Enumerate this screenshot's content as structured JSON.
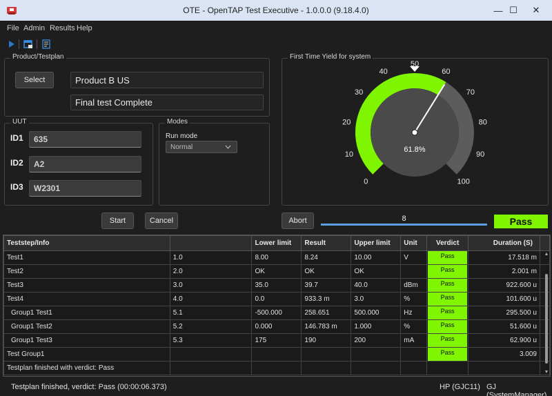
{
  "window": {
    "title": "OTE - OpenTAP Test Executive - 1.0.0.0 (9.18.4.0)",
    "minimize_glyph": "—",
    "maximize_glyph": "☐",
    "close_glyph": "✕"
  },
  "menu": [
    "File",
    "Admin",
    "Results",
    "Help"
  ],
  "toolbar": {
    "icons": [
      "play-icon",
      "edit-plan-icon",
      "report-icon"
    ]
  },
  "product": {
    "group_label": "Product/Testplan",
    "select_label": "Select",
    "product_name": "Product B US",
    "testplan_name": "Final test Complete"
  },
  "uut": {
    "group_label": "UUT",
    "ids": [
      {
        "label": "ID1",
        "value": "635"
      },
      {
        "label": "ID2",
        "value": "A2"
      },
      {
        "label": "ID3",
        "value": "W2301"
      }
    ]
  },
  "modes": {
    "group_label": "Modes",
    "run_mode_label": "Run mode",
    "run_mode_value": "Normal"
  },
  "gauge": {
    "group_label": "First Time Yield for system",
    "value_text": "61.8%",
    "value": 61.8,
    "min": 0,
    "max": 100,
    "tick_labels": [
      "0",
      "10",
      "20",
      "30",
      "40",
      "50",
      "60",
      "70",
      "80",
      "90",
      "100"
    ],
    "arc_color": "#7ff500",
    "needle_color": "#ffffff"
  },
  "controls": {
    "start_label": "Start",
    "cancel_label": "Cancel",
    "abort_label": "Abort",
    "progress_text": "8",
    "progress_fraction": 1.0,
    "verdict": "Pass",
    "verdict_color": "#7ff500"
  },
  "results": {
    "columns": [
      "Teststep/Info",
      "",
      "Lower limit",
      "Result",
      "Upper limit",
      "Unit",
      "Verdict",
      "Duration (S)"
    ],
    "rows": [
      {
        "step": "Test1",
        "id": "1.0",
        "lower": "8.00",
        "result": "8.24",
        "upper": "10.00",
        "unit": "V",
        "verdict": "Pass",
        "duration": "17.518 m"
      },
      {
        "step": "Test2",
        "id": "2.0",
        "lower": "OK",
        "result": "OK",
        "upper": "OK",
        "unit": "",
        "verdict": "Pass",
        "duration": "2.001 m"
      },
      {
        "step": "Test3",
        "id": "3.0",
        "lower": "35.0",
        "result": "39.7",
        "upper": "40.0",
        "unit": "dBm",
        "verdict": "Pass",
        "duration": "922.600 u"
      },
      {
        "step": "Test4",
        "id": "4.0",
        "lower": "0.0",
        "result": "933.3 m",
        "upper": "3.0",
        "unit": "%",
        "verdict": "Pass",
        "duration": "101.600 u"
      },
      {
        "step": "  Group1 Test1",
        "id": "5.1",
        "lower": "-500.000",
        "result": "258.651",
        "upper": "500.000",
        "unit": "Hz",
        "verdict": "Pass",
        "duration": "295.500 u"
      },
      {
        "step": "  Group1 Test2",
        "id": "5.2",
        "lower": "0.000",
        "result": "146.783 m",
        "upper": "1.000",
        "unit": "%",
        "verdict": "Pass",
        "duration": "51.600 u"
      },
      {
        "step": "  Group1 Test3",
        "id": "5.3",
        "lower": "175",
        "result": "190",
        "upper": "200",
        "unit": "mA",
        "verdict": "Pass",
        "duration": "62.900 u"
      },
      {
        "step": "Test Group1",
        "id": "",
        "lower": "",
        "result": "",
        "upper": "",
        "unit": "",
        "verdict": "Pass",
        "duration": "3.009"
      },
      {
        "step": "Testplan finished with verdict: Pass",
        "id": "",
        "lower": "",
        "result": "",
        "upper": "",
        "unit": "",
        "verdict": "",
        "duration": ""
      }
    ]
  },
  "status": {
    "message": "Testplan finished, verdict: Pass (00:00:06.373)",
    "station": "HP (GJC11)",
    "user": "GJ (SystemManager)"
  }
}
